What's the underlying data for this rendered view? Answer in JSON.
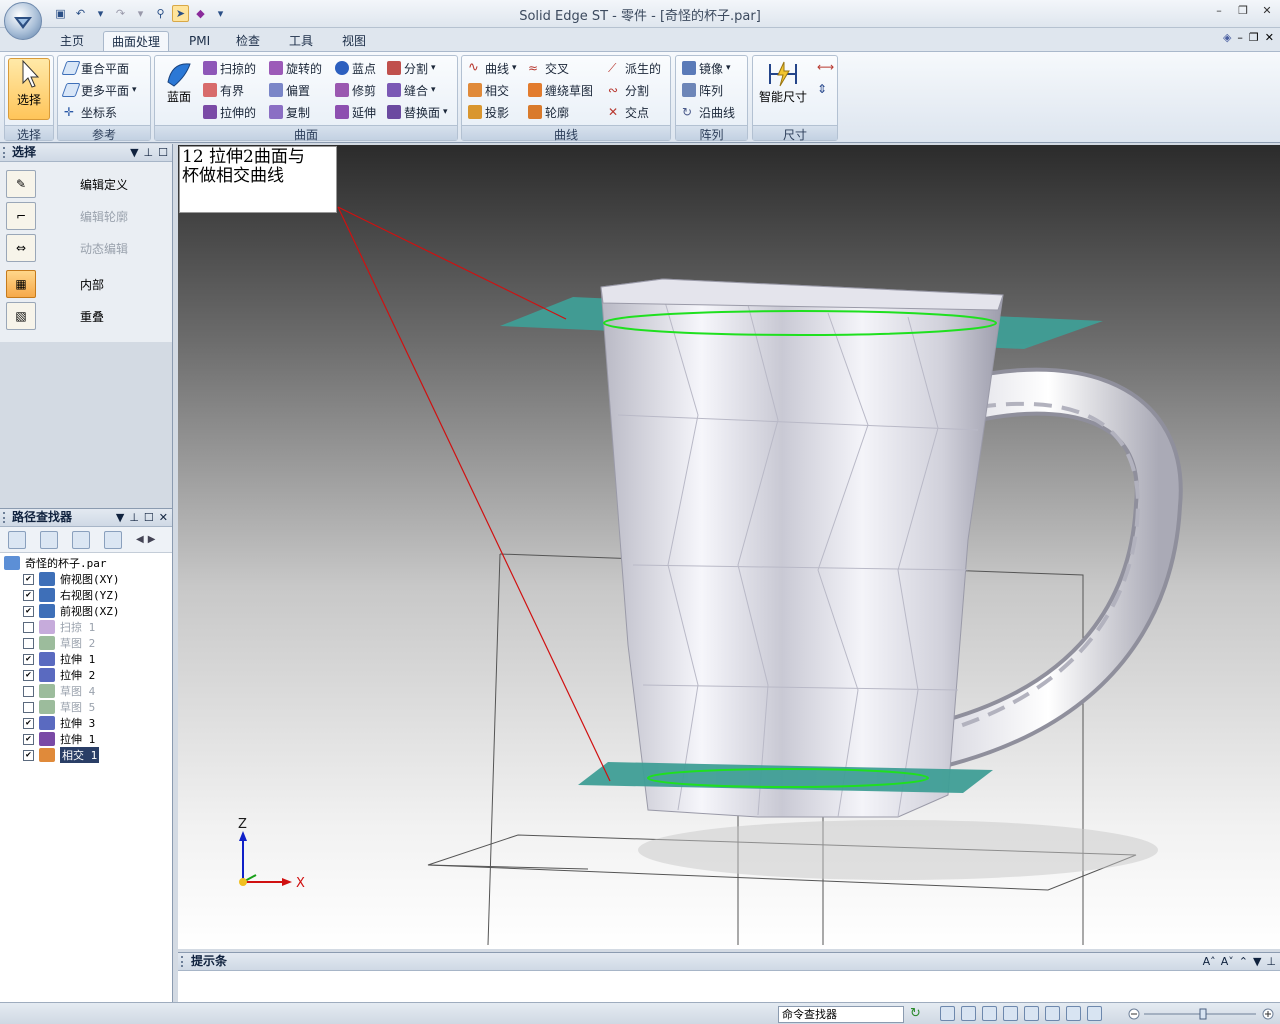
{
  "titlebar": {
    "title": "Solid Edge ST - 零件 - [奇怪的杯子.par]",
    "minimize": "–",
    "restore": "❐",
    "close": "✕"
  },
  "tabs": [
    "主页",
    "曲面处理",
    "PMI",
    "检查",
    "工具",
    "视图"
  ],
  "active_tab": "曲面处理",
  "ribbon": {
    "groups": {
      "select": "选择",
      "reference": "参考",
      "surface": "曲面",
      "curves": "曲线",
      "pattern": "阵列",
      "dimension": "尺寸"
    },
    "select_btn": "选择",
    "coincident_plane": "重合平面",
    "more_planes": "更多平面",
    "coord_system": "坐标系",
    "bluesurf": "蓝面",
    "swept": "扫掠的",
    "bounded": "有界",
    "extruded": "拉伸的",
    "revolved": "旋转的",
    "offset": "偏置",
    "copy": "复制",
    "bluedot": "蓝点",
    "trim": "修剪",
    "extend": "延伸",
    "split": "分割",
    "stitch": "缝合",
    "replace_face": "替换面",
    "curve": "曲线",
    "intersect": "相交",
    "project": "投影",
    "cross": "交叉",
    "wrap_sketch": "缠绕草图",
    "contour": "轮廓",
    "derived": "派生的",
    "split_curve": "分割",
    "intersection_point": "交点",
    "mirror": "镜像",
    "array": "阵列",
    "along_curve": "沿曲线",
    "smart_dim": "智能尺寸"
  },
  "select_pane": {
    "title": "选择",
    "items": [
      {
        "label": "编辑定义",
        "enabled": true
      },
      {
        "label": "编辑轮廓",
        "enabled": false
      },
      {
        "label": "动态编辑",
        "enabled": false
      },
      {
        "label": "内部",
        "enabled": true
      },
      {
        "label": "重叠",
        "enabled": true
      }
    ]
  },
  "pathfinder": {
    "title": "路径查找器",
    "root": "奇怪的杯子.par",
    "items": [
      {
        "label": "俯视图(XY)",
        "checked": true
      },
      {
        "label": "右视图(YZ)",
        "checked": true
      },
      {
        "label": "前视图(XZ)",
        "checked": true
      },
      {
        "label": "扫掠 1",
        "checked": false
      },
      {
        "label": "草图 2",
        "checked": false
      },
      {
        "label": "拉伸 1",
        "checked": true
      },
      {
        "label": "拉伸 2",
        "checked": true
      },
      {
        "label": "草图 4",
        "checked": false
      },
      {
        "label": "草图 5",
        "checked": false
      },
      {
        "label": "拉伸 3",
        "checked": true
      },
      {
        "label": "拉伸 1",
        "checked": true
      },
      {
        "label": "相交 1",
        "checked": true
      }
    ]
  },
  "viewport": {
    "note_line1": "12 拉伸2曲面与",
    "note_line2": "杯做相交曲线",
    "axis_z": "Z",
    "axis_x": "X"
  },
  "prompt_bar": {
    "title": "提示条"
  },
  "status": {
    "command_finder": "命令查找器"
  },
  "colors": {
    "accent_orange": "#ffc55a",
    "surface_teal": "#3f9e96",
    "curve_green": "#1fe01f"
  }
}
